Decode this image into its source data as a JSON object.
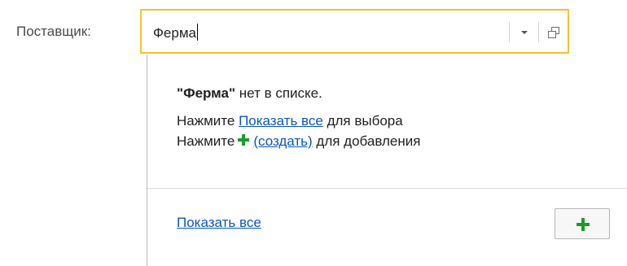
{
  "form": {
    "supplier_label": "Поставщик:",
    "supplier_value": "Ферма"
  },
  "field_icons": {
    "dropdown": "chevron-down-icon",
    "open": "open-form-icon"
  },
  "popup": {
    "not_found_quote_open": "\"",
    "not_found_term": "Ферма",
    "not_found_quote_close": "\"",
    "not_found_text": " нет в списке.",
    "press_label_1": "Нажмите ",
    "show_all_link": "Показать все",
    "for_select_text": " для выбора",
    "press_label_2": "Нажмите",
    "create_link": "(создать)",
    "for_add_text": " для добавления",
    "show_all_bottom_link": "Показать все",
    "add_button_icon": "plus-icon"
  },
  "colors": {
    "focus_border": "#f1c232",
    "link": "#0a57b8",
    "plus": "#1f9a2b"
  }
}
